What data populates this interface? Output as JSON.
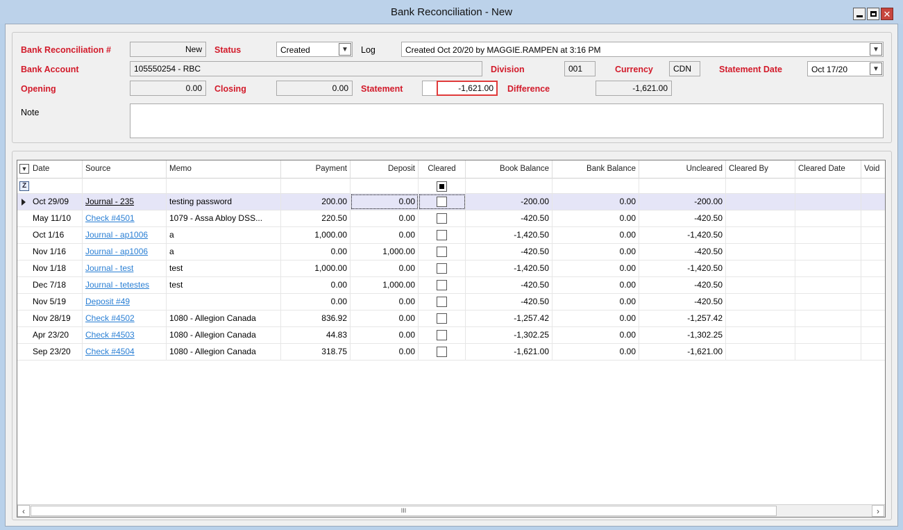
{
  "window": {
    "title": "Bank Reconciliation - New"
  },
  "form": {
    "recon_no_label": "Bank Reconciliation #",
    "recon_no_value": "New",
    "status_label": "Status",
    "status_value": "Created",
    "log_label": "Log",
    "log_value": "Created Oct 20/20 by MAGGIE.RAMPEN at 3:16 PM",
    "bank_account_label": "Bank Account",
    "bank_account_value": "105550254 - RBC",
    "division_label": "Division",
    "division_value": "001",
    "currency_label": "Currency",
    "currency_value": "CDN",
    "statement_date_label": "Statement Date",
    "statement_date_value": "Oct 17/20",
    "opening_label": "Opening",
    "opening_value": "0.00",
    "closing_label": "Closing",
    "closing_value": "0.00",
    "statement_label": "Statement",
    "statement_value": "-1,621.00",
    "difference_label": "Difference",
    "difference_value": "-1,621.00",
    "note_label": "Note",
    "note_value": ""
  },
  "grid": {
    "columns": {
      "date": "Date",
      "source": "Source",
      "memo": "Memo",
      "payment": "Payment",
      "deposit": "Deposit",
      "cleared": "Cleared",
      "book": "Book Balance",
      "bank": "Bank Balance",
      "uncleared": "Uncleared",
      "cleared_by": "Cleared By",
      "cleared_date": "Cleared Date",
      "void": "Void"
    },
    "rows": [
      {
        "date": "Oct 29/09",
        "source": "Journal - 235",
        "memo": "testing password",
        "payment": "200.00",
        "deposit": "0.00",
        "cleared": false,
        "book": "-200.00",
        "bank": "0.00",
        "uncleared": "-200.00",
        "cleared_by": "",
        "cleared_date": "",
        "void": ""
      },
      {
        "date": "May 11/10",
        "source": "Check #4501",
        "memo": "1079 - Assa Abloy DSS...",
        "payment": "220.50",
        "deposit": "0.00",
        "cleared": false,
        "book": "-420.50",
        "bank": "0.00",
        "uncleared": "-420.50",
        "cleared_by": "",
        "cleared_date": "",
        "void": ""
      },
      {
        "date": "Oct 1/16",
        "source": "Journal - ap1006",
        "memo": "a",
        "payment": "1,000.00",
        "deposit": "0.00",
        "cleared": false,
        "book": "-1,420.50",
        "bank": "0.00",
        "uncleared": "-1,420.50",
        "cleared_by": "",
        "cleared_date": "",
        "void": ""
      },
      {
        "date": "Nov 1/16",
        "source": "Journal - ap1006",
        "memo": "a",
        "payment": "0.00",
        "deposit": "1,000.00",
        "cleared": false,
        "book": "-420.50",
        "bank": "0.00",
        "uncleared": "-420.50",
        "cleared_by": "",
        "cleared_date": "",
        "void": ""
      },
      {
        "date": "Nov 1/18",
        "source": "Journal - test",
        "memo": "test",
        "payment": "1,000.00",
        "deposit": "0.00",
        "cleared": false,
        "book": "-1,420.50",
        "bank": "0.00",
        "uncleared": "-1,420.50",
        "cleared_by": "",
        "cleared_date": "",
        "void": ""
      },
      {
        "date": "Dec 7/18",
        "source": "Journal - tetestes",
        "memo": "test",
        "payment": "0.00",
        "deposit": "1,000.00",
        "cleared": false,
        "book": "-420.50",
        "bank": "0.00",
        "uncleared": "-420.50",
        "cleared_by": "",
        "cleared_date": "",
        "void": ""
      },
      {
        "date": "Nov 5/19",
        "source": "Deposit #49",
        "memo": "",
        "payment": "0.00",
        "deposit": "0.00",
        "cleared": false,
        "book": "-420.50",
        "bank": "0.00",
        "uncleared": "-420.50",
        "cleared_by": "",
        "cleared_date": "",
        "void": ""
      },
      {
        "date": "Nov 28/19",
        "source": "Check #4502",
        "memo": "1080 - Allegion Canada",
        "payment": "836.92",
        "deposit": "0.00",
        "cleared": false,
        "book": "-1,257.42",
        "bank": "0.00",
        "uncleared": "-1,257.42",
        "cleared_by": "",
        "cleared_date": "",
        "void": ""
      },
      {
        "date": "Apr 23/20",
        "source": "Check #4503",
        "memo": "1080 - Allegion Canada",
        "payment": "44.83",
        "deposit": "0.00",
        "cleared": false,
        "book": "-1,302.25",
        "bank": "0.00",
        "uncleared": "-1,302.25",
        "cleared_by": "",
        "cleared_date": "",
        "void": ""
      },
      {
        "date": "Sep 23/20",
        "source": "Check #4504",
        "memo": "1080 - Allegion Canada",
        "payment": "318.75",
        "deposit": "0.00",
        "cleared": false,
        "book": "-1,621.00",
        "bank": "0.00",
        "uncleared": "-1,621.00",
        "cleared_by": "",
        "cleared_date": "",
        "void": ""
      }
    ],
    "scrollbar_grip": "III"
  },
  "icons": {
    "minimize": "minimize-icon",
    "maximize": "maximize-icon",
    "close": "close-icon",
    "dropdown": "chevron-down-icon",
    "filter": "filter-icon",
    "row_pointer": "row-pointer-icon"
  },
  "colors": {
    "label_red": "#d21a2a",
    "link_blue": "#2a7fd4",
    "selected_row": "#e5e5f7",
    "highlight_border": "#e03a3a"
  }
}
